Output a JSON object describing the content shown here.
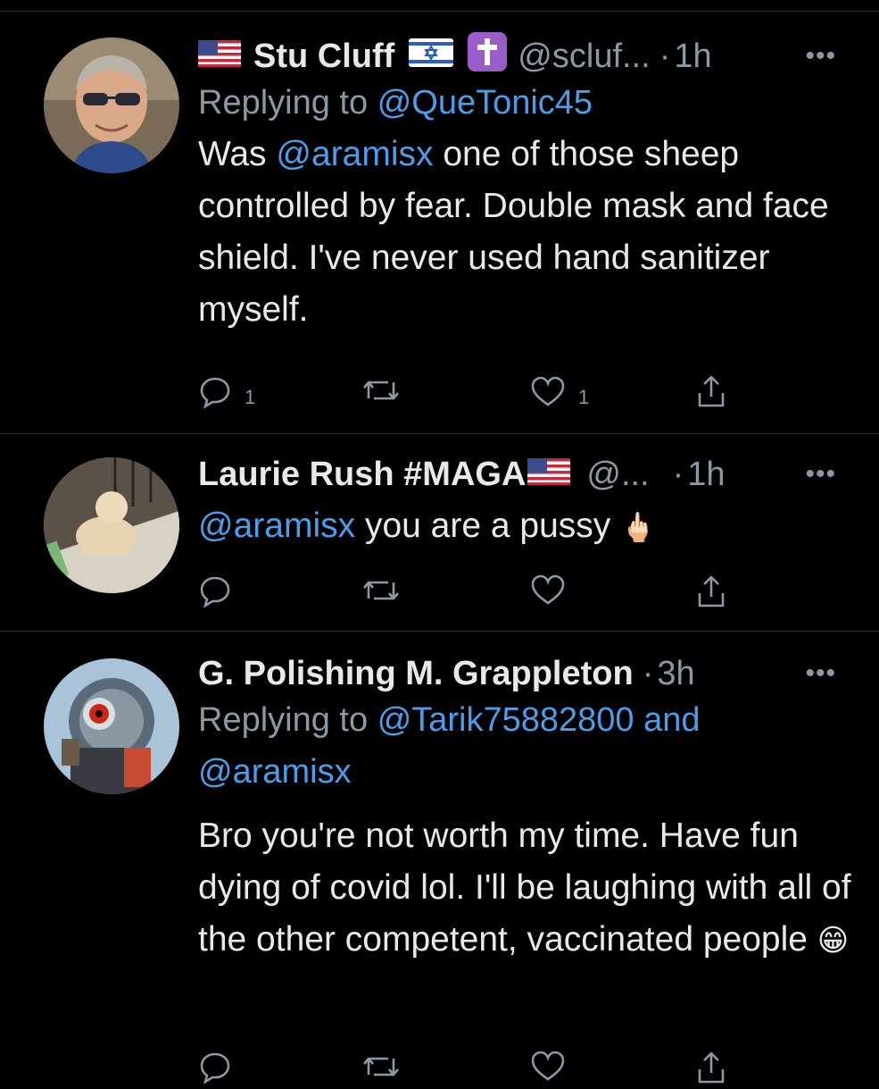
{
  "tweets": [
    {
      "display_name": "Stu Cluff",
      "handle": "@scluf...",
      "separator": "·",
      "time": "1h",
      "more": "•••",
      "replying_prefix": "Replying to",
      "replying_to": "@QueTonic45",
      "replying_to_2": "",
      "mention": "@aramisx",
      "text": " one of those sheep controlled by fear. Double mask and face shield. I've never used hand sanitizer myself.",
      "text_prefix": "Was ",
      "reply_count": "1",
      "retweet_count": "",
      "like_count": "1",
      "badge_icons": [
        "us-flag-icon",
        "israel-flag-icon",
        "cross-icon"
      ]
    },
    {
      "display_name": "Laurie Rush #MAGA",
      "handle": "@...",
      "separator": "·",
      "time": "1h",
      "more": "•••",
      "mention": "@aramisx",
      "text": " you are a pussy ",
      "emoji": "🖕🏻",
      "reply_count": "",
      "retweet_count": "",
      "like_count": "",
      "badge_icons": [
        "us-flag-icon"
      ]
    },
    {
      "display_name": "G. Polishing M. Grappleton",
      "handle": "",
      "separator": "·",
      "time": "3h",
      "more": "•••",
      "replying_prefix": "Replying to",
      "replying_to": "@Tarik75882800 and",
      "replying_to_2": "@aramisx",
      "text": "Bro you're not worth my time. Have fun dying of covid lol. I'll be laughing with all of the other competent, vaccinated people ",
      "emoji": "😁"
    }
  ],
  "colors": {
    "background": "#000000",
    "text": "#e7e9ea",
    "secondary": "#8b98a5",
    "link": "#4a9eea",
    "divider": "#2f3336"
  }
}
